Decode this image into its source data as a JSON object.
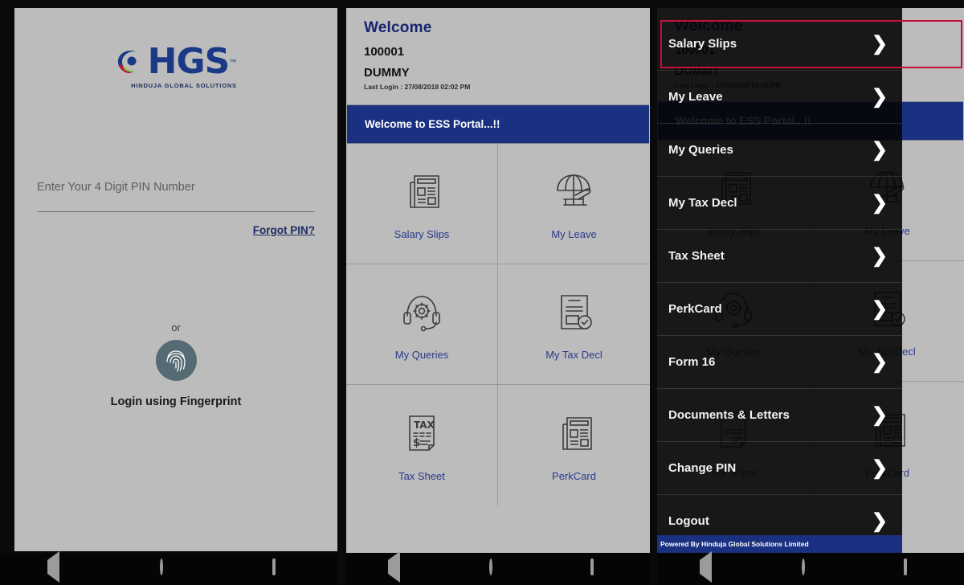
{
  "login": {
    "logo": {
      "wordmark": "HGS",
      "trademark": "™",
      "tagline": "HINDUJA GLOBAL SOLUTIONS"
    },
    "pin_placeholder": "Enter Your 4 Digit PIN Number",
    "pin_value": "",
    "forgot_link": " Forgot PIN?",
    "or_text": "or",
    "fingerprint_caption": "Login using Fingerprint"
  },
  "dashboard": {
    "welcome_title": "Welcome",
    "employee_id": "100001",
    "employee_name": "DUMMY",
    "last_login": "Last Login : 27/08/2018 02:02 PM",
    "banner": "Welcome to ESS Portal...!!",
    "tiles": [
      {
        "label": "Salary Slips",
        "icon": "newspaper-icon"
      },
      {
        "label": "My Leave",
        "icon": "beach-umbrella-icon"
      },
      {
        "label": "My Queries",
        "icon": "headset-gear-icon"
      },
      {
        "label": "My Tax Decl",
        "icon": "document-check-icon"
      },
      {
        "label": "Tax Sheet",
        "icon": "tax-document-icon"
      },
      {
        "label": "PerkCard",
        "icon": "newspaper-icon"
      }
    ]
  },
  "drawer": {
    "items": [
      {
        "label": "Salary Slips",
        "highlighted": true
      },
      {
        "label": "My Leave",
        "highlighted": false
      },
      {
        "label": "My Queries",
        "highlighted": false
      },
      {
        "label": "My Tax Decl",
        "highlighted": false
      },
      {
        "label": "Tax Sheet",
        "highlighted": false
      },
      {
        "label": "PerkCard",
        "highlighted": false
      },
      {
        "label": "Form 16",
        "highlighted": false
      },
      {
        "label": "Documents & Letters",
        "highlighted": false
      },
      {
        "label": "Change PIN",
        "highlighted": false
      },
      {
        "label": "Logout",
        "highlighted": false
      }
    ],
    "chevron": "❯",
    "footer": "Powered By Hinduja Global Solutions Limited",
    "highlight_color": "#c2113a"
  },
  "navbar": {
    "back": "back-triangle-icon",
    "home": "home-circle-icon",
    "recents": "recents-square-icon"
  },
  "colors": {
    "brand_blue": "#1a3080",
    "logo_blue": "#1a3a87",
    "screen_bg": "#bcbcbc",
    "highlight_red": "#c2113a"
  }
}
